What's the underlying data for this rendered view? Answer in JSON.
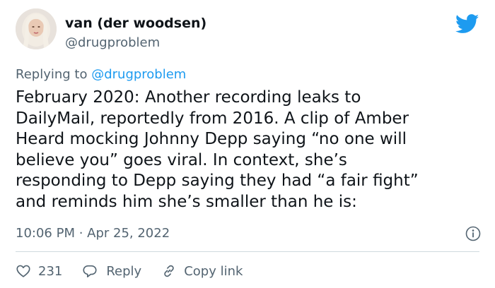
{
  "author": {
    "display_name": "van (der woodsen)",
    "handle": "@drugproblem"
  },
  "reply_context": {
    "prefix": "Replying to ",
    "mention": "@drugproblem"
  },
  "tweet": {
    "lines": [
      "February 2020: Another recording leaks to",
      "DailyMail, reportedly from 2016. A clip of Amber",
      "Heard mocking Johnny Depp saying “no one will",
      "believe you” goes viral. In context, she’s",
      "responding to Depp saying they had “a fair fight”",
      "and reminds him she’s smaller than he is:"
    ],
    "timestamp": "10:06 PM · Apr 25, 2022"
  },
  "actions": {
    "like_count": "231",
    "reply_label": "Reply",
    "copy_link_label": "Copy link"
  },
  "icons": {
    "brand": "twitter-bird-icon",
    "info": "info-icon",
    "like": "heart-icon",
    "reply": "speech-bubble-icon",
    "copy_link": "link-icon"
  },
  "colors": {
    "brand_blue": "#1d9bf0",
    "text_primary": "#0f1419",
    "text_secondary": "#536471",
    "divider": "#cfd9de"
  }
}
